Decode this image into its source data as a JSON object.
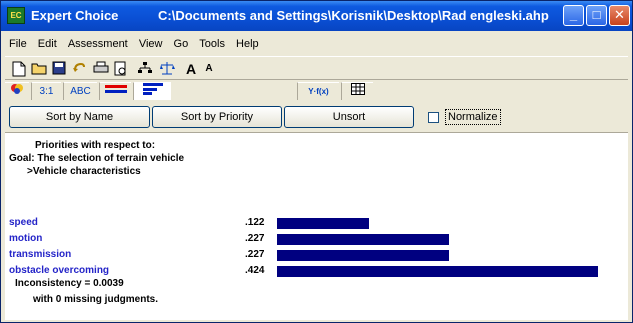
{
  "window": {
    "title": "Expert Choice",
    "path": "C:\\Documents and Settings\\Korisnik\\Desktop\\Rad engleski.ahp",
    "app_icon_text": "EC",
    "minimize": "_",
    "maximize": "□",
    "close": "✕"
  },
  "menu": [
    {
      "label": "File"
    },
    {
      "label": "Edit"
    },
    {
      "label": "Assessment"
    },
    {
      "label": "View"
    },
    {
      "label": "Go"
    },
    {
      "label": "Tools"
    },
    {
      "label": "Help"
    }
  ],
  "toolbar": {
    "icons": [
      "new-file-icon",
      "open-folder-icon",
      "save-icon",
      "undo-icon",
      "print-icon",
      "print-preview-icon",
      "hierarchy-icon",
      "balance-icon",
      "font-larger-icon",
      "font-smaller-icon"
    ],
    "font_larger": "A",
    "font_smaller": "A"
  },
  "tabs": {
    "ratio": "3:1",
    "abc": "ABC",
    "formula": "Y·f(x)"
  },
  "buttons": {
    "sort_by_name": "Sort by Name",
    "sort_by_priority": "Sort by Priority",
    "unsort": "Unsort",
    "normalize": "Normalize"
  },
  "content": {
    "header_line1": "Priorities with respect to:",
    "header_line2": "Goal: The selection of terrain vehicle",
    "header_line3": ">Vehicle characteristics",
    "bar_color": "#000080",
    "criteria_color": "#2424c8",
    "items": [
      {
        "name": "speed",
        "value": ".122",
        "priority": 0.122
      },
      {
        "name": "motion",
        "value": ".227",
        "priority": 0.227
      },
      {
        "name": "transmission",
        "value": ".227",
        "priority": 0.227
      },
      {
        "name": "obstacle overcoming",
        "value": ".424",
        "priority": 0.424
      }
    ],
    "inconsistency": "Inconsistency = 0.0039",
    "missing": "with 0  missing judgments."
  }
}
